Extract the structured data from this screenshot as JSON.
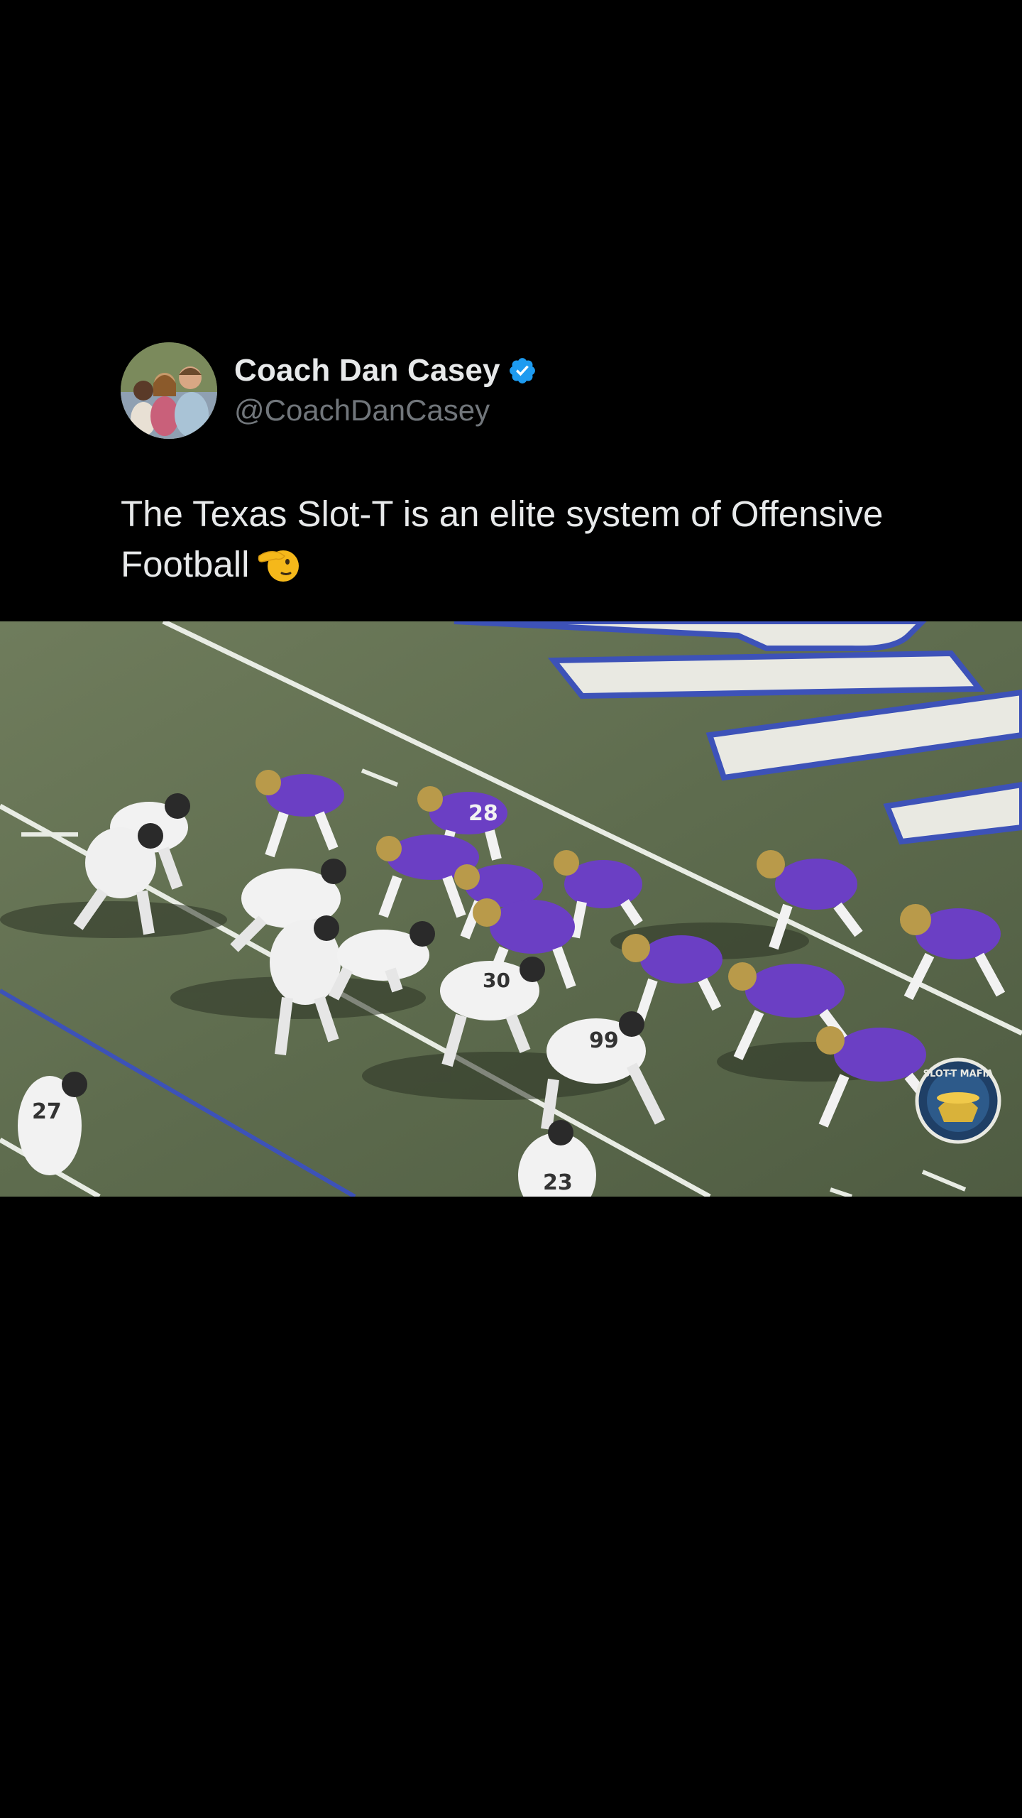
{
  "post": {
    "author": {
      "display_name": "Coach Dan Casey",
      "handle": "@CoachDanCasey",
      "verified": true,
      "verified_icon": "verified-badge-icon",
      "verified_color": "#1d9bf0"
    },
    "text": "The Texas Slot-T is an elite system of Offensive Football",
    "emoji": "salute-face-emoji"
  },
  "media": {
    "type": "video-frame",
    "watermark": {
      "text": "SLOT-T MAFIA",
      "icon": "slot-t-mafia-logo"
    },
    "jersey_numbers": [
      "28",
      "27",
      "30",
      "99",
      "23"
    ]
  },
  "colors": {
    "background": "#000000",
    "text_primary": "#e7e9ea",
    "text_secondary": "#71767b",
    "home_team": "#6b3fc4",
    "away_team": "#f2f2f2",
    "field": "#5e6d4f"
  }
}
